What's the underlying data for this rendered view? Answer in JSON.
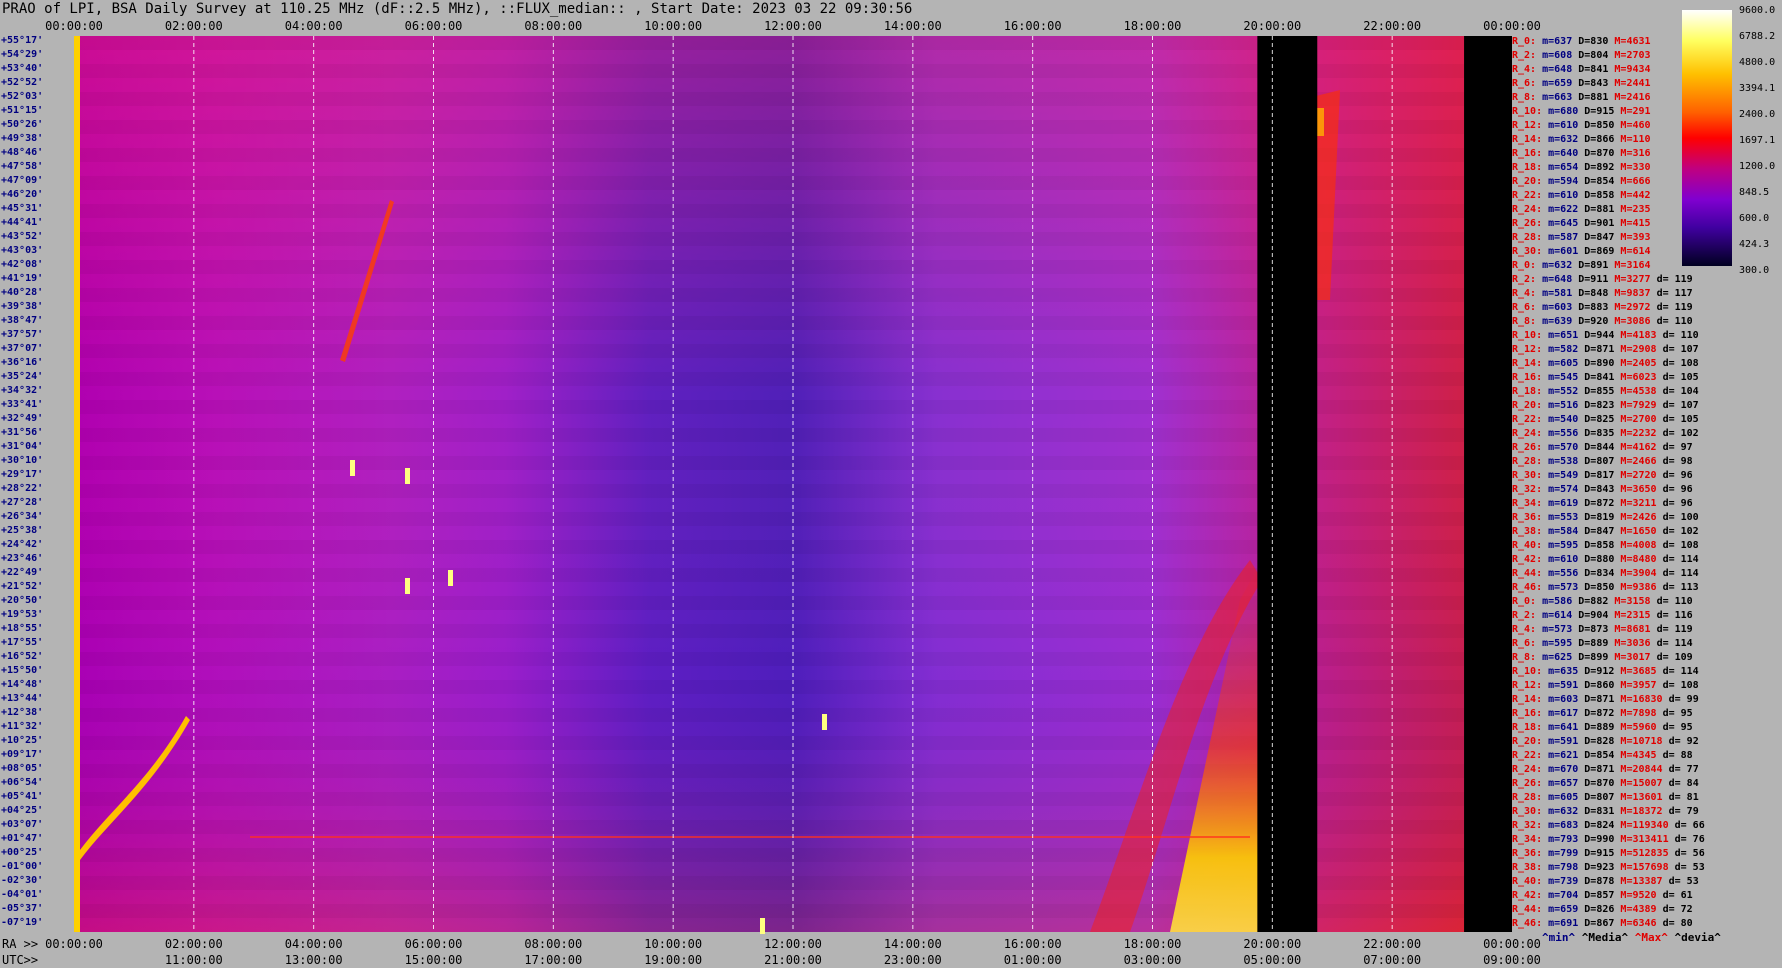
{
  "title": "PRAO of LPI, BSA Daily Survey at 110.25 MHz (dF::2.5 MHz), ::FLUX_median:: , Start Date: 2023 03 22 09:30:56",
  "chart_data": {
    "type": "heatmap",
    "title": "PRAO of LPI, BSA Daily Survey at 110.25 MHz (dF::2.5 MHz), ::FLUX_median:: , Start Date: 2023 03 22 09:30:56",
    "x_top_labels": [
      "00:00:00",
      "02:00:00",
      "04:00:00",
      "06:00:00",
      "08:00:00",
      "10:00:00",
      "12:00:00",
      "14:00:00",
      "16:00:00",
      "18:00:00",
      "20:00:00",
      "22:00:00",
      "00:00:00"
    ],
    "x_ra_labels": [
      "00:00:00",
      "02:00:00",
      "04:00:00",
      "06:00:00",
      "08:00:00",
      "10:00:00",
      "12:00:00",
      "14:00:00",
      "16:00:00",
      "18:00:00",
      "20:00:00",
      "22:00:00",
      "00:00:00"
    ],
    "x_utc_labels": [
      "11:00:00",
      "13:00:00",
      "15:00:00",
      "17:00:00",
      "19:00:00",
      "21:00:00",
      "23:00:00",
      "01:00:00",
      "03:00:00",
      "05:00:00",
      "07:00:00",
      "09:00:00"
    ],
    "ra_label": "RA >>",
    "utc_label": "UTC>>",
    "declinations": [
      "+55°17'",
      "+54°29'",
      "+53°40'",
      "+52°52'",
      "+52°03'",
      "+51°15'",
      "+50°26'",
      "+49°38'",
      "+48°46'",
      "+47°58'",
      "+47°09'",
      "+46°20'",
      "+45°31'",
      "+44°41'",
      "+43°52'",
      "+43°03'",
      "+42°08'",
      "+41°19'",
      "+40°28'",
      "+39°38'",
      "+38°47'",
      "+37°57'",
      "+37°07'",
      "+36°16'",
      "+35°24'",
      "+34°32'",
      "+33°41'",
      "+32°49'",
      "+31°56'",
      "+31°04'",
      "+30°10'",
      "+29°17'",
      "+28°22'",
      "+27°28'",
      "+26°34'",
      "+25°38'",
      "+24°42'",
      "+23°46'",
      "+22°49'",
      "+21°52'",
      "+20°50'",
      "+19°53'",
      "+18°55'",
      "+17°55'",
      "+16°52'",
      "+15°50'",
      "+14°48'",
      "+13°44'",
      "+12°38'",
      "+11°32'",
      "+10°25'",
      "+09°17'",
      "+08°05'",
      "+06°54'",
      "+05°41'",
      "+04°25'",
      "+03°07'",
      "+01°47'",
      "+00°25'",
      "-01°00'",
      "-02°30'",
      "-04°01'",
      "-05°37'",
      "-07°19'"
    ],
    "colorbar_ticks": [
      "9600.0",
      "6788.2",
      "4800.0",
      "3394.1",
      "2400.0",
      "1697.1",
      "1200.0",
      "848.5",
      "600.0",
      "424.3",
      "300.0"
    ],
    "gaps_hours": [
      [
        19.75,
        20.75
      ],
      [
        23.2,
        24.0
      ]
    ],
    "stats": [
      [
        "R_0:",
        "m=637",
        "D=830",
        "M=4631",
        ""
      ],
      [
        "R_2:",
        "m=608",
        "D=804",
        "M=2703",
        ""
      ],
      [
        "R_4:",
        "m=648",
        "D=841",
        "M=9434",
        ""
      ],
      [
        "R_6:",
        "m=659",
        "D=843",
        "M=2441",
        ""
      ],
      [
        "R_8:",
        "m=663",
        "D=881",
        "M=2416",
        ""
      ],
      [
        "R_10:",
        "m=680",
        "D=915",
        "M=291",
        ""
      ],
      [
        "R_12:",
        "m=610",
        "D=850",
        "M=460",
        ""
      ],
      [
        "R_14:",
        "m=632",
        "D=866",
        "M=110",
        ""
      ],
      [
        "R_16:",
        "m=640",
        "D=870",
        "M=316",
        ""
      ],
      [
        "R_18:",
        "m=654",
        "D=892",
        "M=330",
        ""
      ],
      [
        "R_20:",
        "m=594",
        "D=854",
        "M=666",
        ""
      ],
      [
        "R_22:",
        "m=610",
        "D=858",
        "M=442",
        ""
      ],
      [
        "R_24:",
        "m=622",
        "D=881",
        "M=235",
        ""
      ],
      [
        "R_26:",
        "m=645",
        "D=901",
        "M=415",
        ""
      ],
      [
        "R_28:",
        "m=587",
        "D=847",
        "M=393",
        ""
      ],
      [
        "R_30:",
        "m=601",
        "D=869",
        "M=614",
        ""
      ],
      [
        "R_0:",
        "m=632",
        "D=891",
        "M=3164",
        ""
      ],
      [
        "R_2:",
        "m=648",
        "D=911",
        "M=3277",
        "d= 119"
      ],
      [
        "R_4:",
        "m=581",
        "D=848",
        "M=9837",
        "d= 117"
      ],
      [
        "R_6:",
        "m=603",
        "D=883",
        "M=2972",
        "d= 119"
      ],
      [
        "R_8:",
        "m=639",
        "D=920",
        "M=3086",
        "d= 110"
      ],
      [
        "R_10:",
        "m=651",
        "D=944",
        "M=4183",
        "d= 110"
      ],
      [
        "R_12:",
        "m=582",
        "D=871",
        "M=2908",
        "d= 107"
      ],
      [
        "R_14:",
        "m=605",
        "D=890",
        "M=2405",
        "d= 108"
      ],
      [
        "R_16:",
        "m=545",
        "D=841",
        "M=6023",
        "d= 105"
      ],
      [
        "R_18:",
        "m=552",
        "D=855",
        "M=4538",
        "d= 104"
      ],
      [
        "R_20:",
        "m=516",
        "D=823",
        "M=7929",
        "d= 107"
      ],
      [
        "R_22:",
        "m=540",
        "D=825",
        "M=2700",
        "d= 105"
      ],
      [
        "R_24:",
        "m=556",
        "D=835",
        "M=2232",
        "d= 102"
      ],
      [
        "R_26:",
        "m=570",
        "D=844",
        "M=4162",
        "d= 97"
      ],
      [
        "R_28:",
        "m=538",
        "D=807",
        "M=2466",
        "d= 98"
      ],
      [
        "R_30:",
        "m=549",
        "D=817",
        "M=2720",
        "d= 96"
      ],
      [
        "R_32:",
        "m=574",
        "D=843",
        "M=3650",
        "d= 96"
      ],
      [
        "R_34:",
        "m=619",
        "D=872",
        "M=3211",
        "d= 96"
      ],
      [
        "R_36:",
        "m=553",
        "D=819",
        "M=2426",
        "d= 100"
      ],
      [
        "R_38:",
        "m=584",
        "D=847",
        "M=1650",
        "d= 102"
      ],
      [
        "R_40:",
        "m=595",
        "D=858",
        "M=4008",
        "d= 108"
      ],
      [
        "R_42:",
        "m=610",
        "D=880",
        "M=8480",
        "d= 114"
      ],
      [
        "R_44:",
        "m=556",
        "D=834",
        "M=3904",
        "d= 114"
      ],
      [
        "R_46:",
        "m=573",
        "D=850",
        "M=9386",
        "d= 113"
      ],
      [
        "R_0:",
        "m=586",
        "D=882",
        "M=3158",
        "d= 110"
      ],
      [
        "R_2:",
        "m=614",
        "D=904",
        "M=2315",
        "d= 116"
      ],
      [
        "R_4:",
        "m=573",
        "D=873",
        "M=8681",
        "d= 119"
      ],
      [
        "R_6:",
        "m=595",
        "D=889",
        "M=3036",
        "d= 114"
      ],
      [
        "R_8:",
        "m=625",
        "D=899",
        "M=3017",
        "d= 109"
      ],
      [
        "R_10:",
        "m=635",
        "D=912",
        "M=3685",
        "d= 114"
      ],
      [
        "R_12:",
        "m=591",
        "D=860",
        "M=3957",
        "d= 108"
      ],
      [
        "R_14:",
        "m=603",
        "D=871",
        "M=16830",
        "d= 99"
      ],
      [
        "R_16:",
        "m=617",
        "D=872",
        "M=7898",
        "d= 95"
      ],
      [
        "R_18:",
        "m=641",
        "D=889",
        "M=5960",
        "d= 95"
      ],
      [
        "R_20:",
        "m=591",
        "D=828",
        "M=10718",
        "d= 92"
      ],
      [
        "R_22:",
        "m=621",
        "D=854",
        "M=4345",
        "d= 88"
      ],
      [
        "R_24:",
        "m=670",
        "D=871",
        "M=20844",
        "d= 77"
      ],
      [
        "R_26:",
        "m=657",
        "D=870",
        "M=15007",
        "d= 84"
      ],
      [
        "R_28:",
        "m=605",
        "D=807",
        "M=13601",
        "d= 81"
      ],
      [
        "R_30:",
        "m=632",
        "D=831",
        "M=18372",
        "d= 79"
      ],
      [
        "R_32:",
        "m=683",
        "D=824",
        "M=119340",
        "d= 66"
      ],
      [
        "R_34:",
        "m=793",
        "D=990",
        "M=313411",
        "d= 76"
      ],
      [
        "R_36:",
        "m=799",
        "D=915",
        "M=512835",
        "d= 56"
      ],
      [
        "R_38:",
        "m=798",
        "D=923",
        "M=157698",
        "d= 53"
      ],
      [
        "R_40:",
        "m=739",
        "D=878",
        "M=13387",
        "d= 53"
      ],
      [
        "R_42:",
        "m=704",
        "D=857",
        "M=9520",
        "d= 61"
      ],
      [
        "R_44:",
        "m=659",
        "D=826",
        "M=4389",
        "d= 72"
      ],
      [
        "R_46:",
        "m=691",
        "D=867",
        "M=6346",
        "d= 80"
      ]
    ],
    "legend": {
      "min": "^min^",
      "median": "^Media^",
      "max": "^Max^",
      "dev": "^devia^"
    }
  }
}
